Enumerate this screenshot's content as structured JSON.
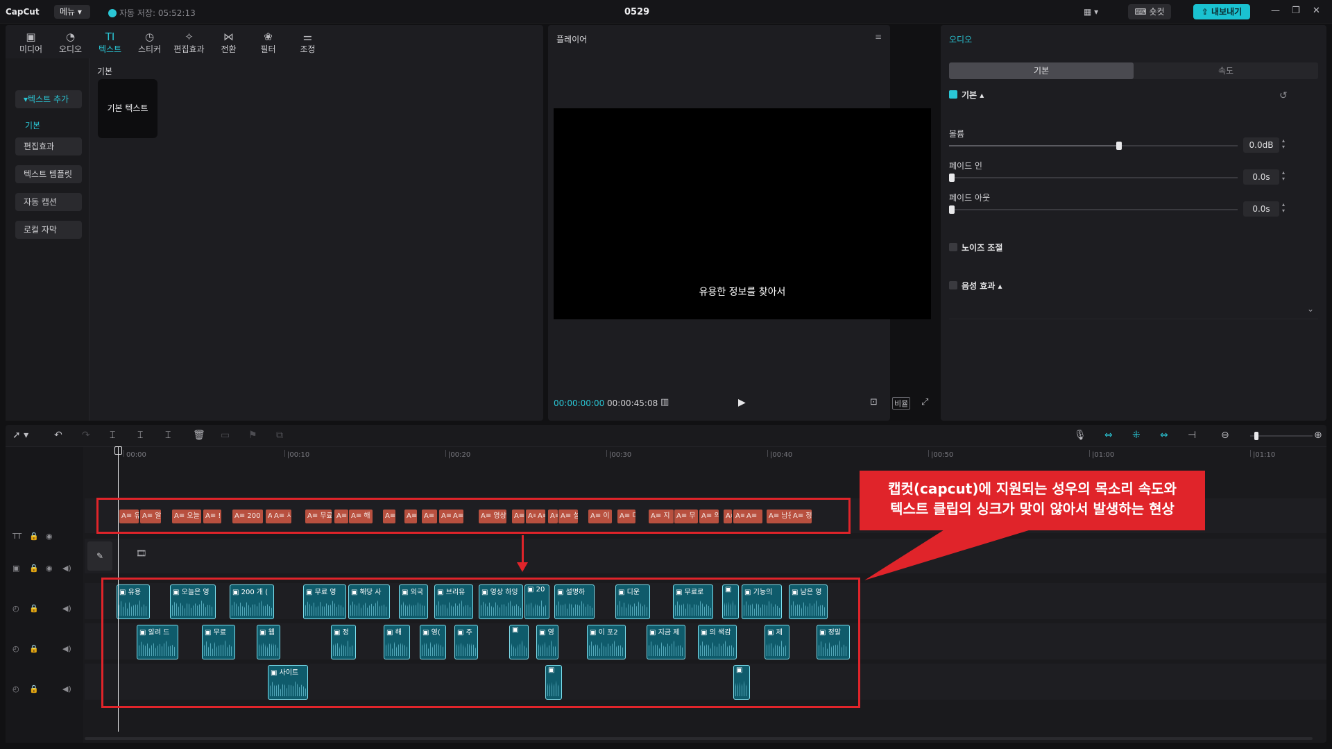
{
  "app": {
    "logo": "CapCut",
    "menu_label": "메뉴",
    "autosave": "자동 저장: 05:52:13",
    "project_title": "0529",
    "shortcut_label": "숏컷",
    "export_label": "내보내기"
  },
  "categories": [
    {
      "label": "미디어",
      "icon": "media-icon"
    },
    {
      "label": "오디오",
      "icon": "audio-icon"
    },
    {
      "label": "텍스트",
      "icon": "text-icon"
    },
    {
      "label": "스티커",
      "icon": "sticker-icon"
    },
    {
      "label": "편집효과",
      "icon": "effects-icon"
    },
    {
      "label": "전환",
      "icon": "transition-icon"
    },
    {
      "label": "필터",
      "icon": "filter-icon"
    },
    {
      "label": "조정",
      "icon": "adjust-icon"
    }
  ],
  "text_sidebar": {
    "add_text": "텍스트 추가",
    "basic": "기본",
    "items": [
      "편집효과",
      "텍스트 템플릿",
      "자동 캡션",
      "로컬 자막"
    ]
  },
  "text_library": {
    "section": "기본",
    "card": "기본 텍스트"
  },
  "player": {
    "title": "플레이어",
    "subtitle": "유용한 정보를 찾아서",
    "current_time": "00:00:00:00",
    "total_time": "00:00:45:08",
    "ratio_label": "비율"
  },
  "audio_panel": {
    "title": "오디오",
    "tabs": [
      "기본",
      "속도"
    ],
    "basic_label": "기본",
    "volume_label": "볼륨",
    "volume_value": "0.0dB",
    "volume_level": 0.59,
    "fade_in_label": "페이드 인",
    "fade_in_value": "0.0s",
    "fade_out_label": "페이드 아웃",
    "fade_out_value": "0.0s",
    "noise_label": "노이즈 조절",
    "voice_effect_label": "음성 효과"
  },
  "ruler": [
    "00:00",
    "|00:10",
    "|00:20",
    "|00:30",
    "|00:40",
    "|00:50",
    "|01:00",
    "|01:10"
  ],
  "text_clips": [
    "A≡ 유",
    "A≡ 알",
    "A≡ 오늘",
    "A≡ !",
    "A≡ 200",
    "A≡",
    "A≡ 사",
    "A≡ 무료",
    "A≡",
    "A≡ 해",
    "A≡",
    "A≡",
    "A≡",
    "A≡ 노",
    "A≡",
    "A≡ 영상",
    "A≡",
    "A≡",
    "A≡",
    "A≡",
    "A≡ 설",
    "A≡ 이",
    "A≡ 디",
    "A≡ 지",
    "A≡ 무",
    "A≡ 의",
    "A≡",
    "A≡ 기",
    "A≡",
    "A≡ 남은",
    "A≡ 정"
  ],
  "audio_row1": [
    "유용",
    "오늘은 영",
    "200 개 (",
    "무료 영",
    "해당 사",
    "외국",
    "브리유",
    "영상 하잉",
    "20",
    "설명하",
    "디운",
    "무료로",
    "",
    "기능의",
    "남은 영"
  ],
  "audio_row2": [
    "알려 드",
    "무료",
    "웹",
    "정",
    "해",
    "영(",
    "주",
    "",
    "영",
    "이 포2",
    "지금 제",
    "의 색감",
    "제",
    "정말"
  ],
  "audio_row3": [
    "사이트",
    "",
    ""
  ],
  "annotation": {
    "line1": "캡컷(capcut)에 지원되는 성우의 목소리 속도와",
    "line2": "텍스트 클립의 싱크가 맞이 않아서 발생하는 현상"
  },
  "colors": {
    "accent": "#2ac7d6",
    "text_clip": "#b8503f",
    "audio_clip": "#0f5b6b",
    "annotation": "#e0242a"
  }
}
